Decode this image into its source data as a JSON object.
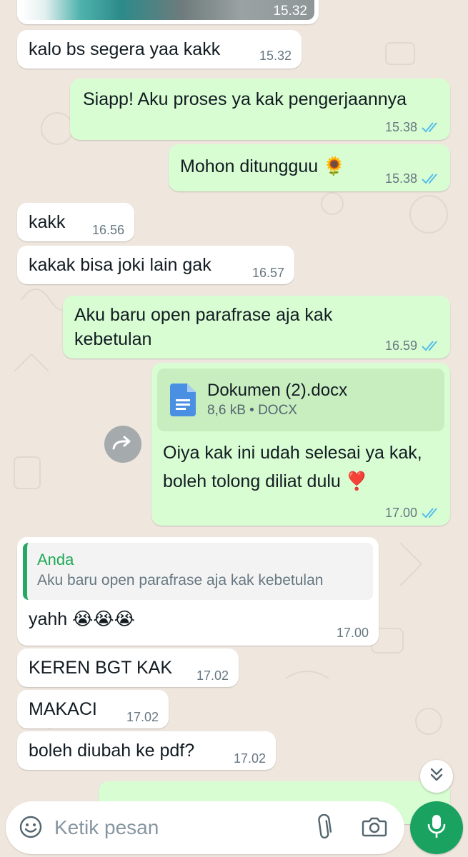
{
  "chat": {
    "top_image_time": "15.32",
    "messages": [
      {
        "dir": "in",
        "text": "kalo bs segera yaa kakk",
        "time": "15.32"
      },
      {
        "dir": "out",
        "text": "Siapp! Aku proses ya kak pengerjaannya",
        "time": "15.38"
      },
      {
        "dir": "out",
        "text": "Mohon ditungguu 🌻",
        "time": "15.38"
      },
      {
        "dir": "in",
        "text": "kakk",
        "time": "16.56"
      },
      {
        "dir": "in",
        "text": "kakak bisa joki lain gak",
        "time": "16.57"
      },
      {
        "dir": "out",
        "text": "Aku baru open parafrase aja kak kebetulan",
        "time": "16.59"
      },
      {
        "dir": "out",
        "doc_name": "Dokumen (2).docx",
        "doc_info": "8,6 kB • DOCX",
        "text": "Oiya kak ini udah selesai ya kak, boleh tolong diliat dulu ❣️",
        "time": "17.00"
      },
      {
        "dir": "in",
        "quote_author": "Anda",
        "quote_text": "Aku baru open parafrase aja kak kebetulan",
        "text": "yahh 😭😭😭",
        "time": "17.00"
      },
      {
        "dir": "in",
        "text": "KEREN BGT KAK",
        "time": "17.02"
      },
      {
        "dir": "in",
        "text": "MAKACI",
        "time": "17.02"
      },
      {
        "dir": "in",
        "text": "boleh diubah ke pdf?",
        "time": "17.02"
      }
    ]
  },
  "composer": {
    "placeholder": "Ketik pesan"
  },
  "icons": {
    "emoji": "emoji-icon",
    "attach": "paperclip-icon",
    "camera": "camera-icon",
    "mic": "mic-icon",
    "forward": "forward-icon",
    "scroll": "double-chevron-down-icon",
    "doc": "document-icon",
    "read": "double-check-icon"
  },
  "colors": {
    "background": "#efe7de",
    "incoming": "#ffffff",
    "outgoing": "#d9fdd3",
    "accent": "#1aa260",
    "read_tick": "#53bdeb",
    "quote_author": "#1fa855"
  }
}
